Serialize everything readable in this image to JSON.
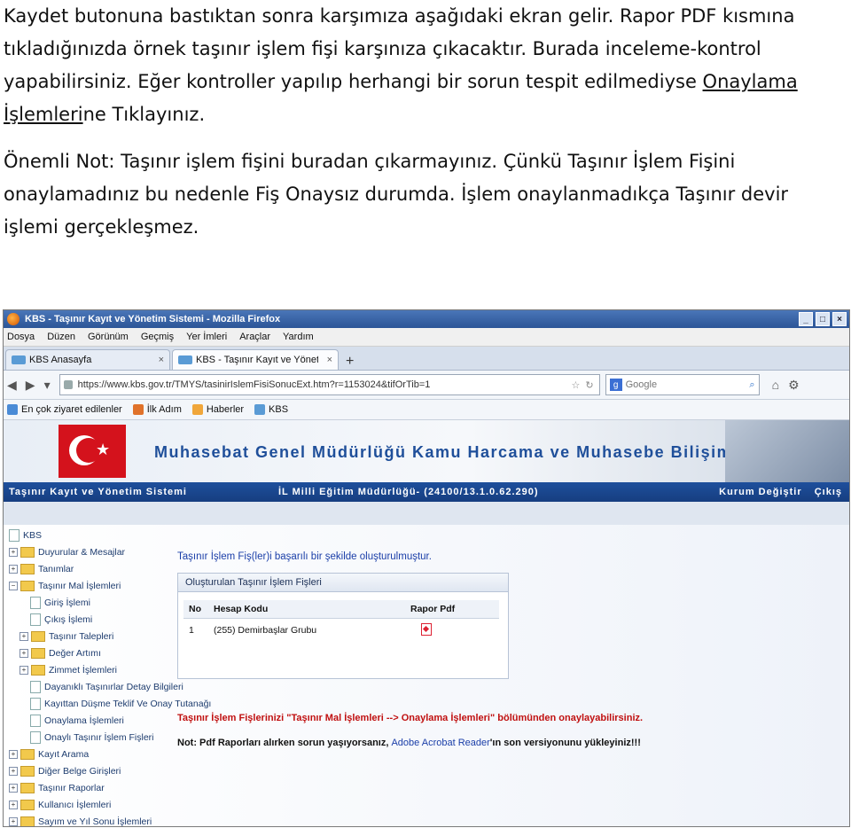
{
  "doc": {
    "p1": "Kaydet butonuna bastıktan sonra karşımıza aşağıdaki ekran gelir. Rapor PDF kısmına tıkladığınızda örnek taşınır işlem fişi karşınıza çıkacaktır. Burada inceleme-kontrol yapabilirsiniz. Eğer kontroller yapılıp herhangi bir sorun tespit edilmediyse ",
    "p1_link": "Onaylama İşlemleri",
    "p1_end": "ne Tıklayınız.",
    "p2": "Önemli Not: Taşınır işlem fişini buradan çıkarmayınız. Çünkü Taşınır İşlem Fişini onaylamadınız bu nedenle Fiş Onaysız durumda. İşlem onaylanmadıkça Taşınır devir işlemi gerçekleşmez."
  },
  "browser": {
    "window_title": "KBS - Taşınır Kayıt ve Yönetim Sistemi - Mozilla Firefox",
    "menu": [
      "Dosya",
      "Düzen",
      "Görünüm",
      "Geçmiş",
      "Yer İmleri",
      "Araçlar",
      "Yardım"
    ],
    "tabs": [
      {
        "label": "KBS Anasayfa",
        "close": "×"
      },
      {
        "label": "KBS - Taşınır Kayıt ve Yönetim Sistemi",
        "close": "×"
      }
    ],
    "new_tab": "+",
    "url": "https://www.kbs.gov.tr/TMYS/tasinirIslemFisiSonucExt.htm?r=1153024&tifOrTib=1",
    "search_placeholder": "Google",
    "bookmarks": [
      "En çok ziyaret edilenler",
      "İlk Adım",
      "Haberler",
      "KBS"
    ]
  },
  "banner": {
    "title": "Muhasebat Genel Müdürlüğü Kamu Harcama ve Muhasebe Bilişim Sistemi"
  },
  "appbar": {
    "system": "Taşınır Kayıt ve Yönetim Sistemi",
    "unit": "İL Milli Eğitim Müdürlüğü- (24100/13.1.0.62.290)",
    "change": "Kurum Değiştir",
    "exit": "Çıkış"
  },
  "tree": {
    "root": "KBS",
    "items": [
      {
        "label": "Duyurular & Mesajlar"
      },
      {
        "label": "Tanımlar"
      },
      {
        "label": "Taşınır Mal İşlemleri"
      },
      {
        "label": "Giriş İşlemi"
      },
      {
        "label": "Çıkış İşlemi"
      },
      {
        "label": "Taşınır Talepleri"
      },
      {
        "label": "Değer Artımı"
      },
      {
        "label": "Zimmet İşlemleri"
      },
      {
        "label": "Dayanıklı Taşınırlar Detay Bilgileri"
      },
      {
        "label": "Kayıttan Düşme Teklif Ve Onay Tutanağı"
      },
      {
        "label": "Onaylama İşlemleri"
      },
      {
        "label": "Onaylı Taşınır İşlem Fişleri"
      },
      {
        "label": "Kayıt Arama"
      },
      {
        "label": "Diğer Belge Girişleri"
      },
      {
        "label": "Taşınır Raporlar"
      },
      {
        "label": "Kullanıcı İşlemleri"
      },
      {
        "label": "Sayım ve Yıl Sonu İşlemleri"
      }
    ]
  },
  "main": {
    "success": "Taşınır İşlem Fiş(ler)i başarılı bir şekilde oluşturulmuştur.",
    "panel_title": "Oluşturulan Taşınır İşlem Fişleri",
    "columns": [
      "No",
      "Hesap Kodu",
      "Rapor Pdf"
    ],
    "rows": [
      {
        "no": "1",
        "hesap": "(255) Demirbaşlar Grubu"
      }
    ],
    "warning": "Taşınır İşlem Fişlerinizi \"Taşınır Mal İşlemleri --> Onaylama İşlemleri\" bölümünden onaylayabilirsiniz.",
    "note_prefix": "Not: Pdf Raporları alırken sorun yaşıyorsanız,",
    "note_link": "Adobe Acrobat Reader",
    "note_suffix": "'ın son versiyonunu yükleyiniz!!!"
  }
}
